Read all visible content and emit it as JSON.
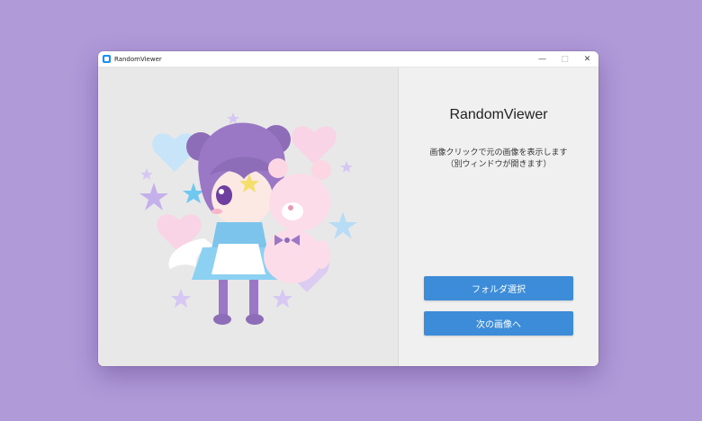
{
  "window": {
    "title": "RandomViewer",
    "controls": {
      "minimize": "—",
      "maximize": "□",
      "close": "✕"
    }
  },
  "main": {
    "heading": "RandomViewer",
    "instruction_line1": "画像クリックで元の画像を表示します",
    "instruction_line2": "（別ウィンドウが開きます）",
    "folder_button": "フォルダ選択",
    "next_button": "次の画像へ"
  },
  "colors": {
    "desktop": "#b09ad8",
    "button": "#3d8cd9",
    "image_bg": "#e8e8e8"
  },
  "icons": [
    "app-icon",
    "minimize-icon",
    "maximize-icon",
    "close-icon"
  ]
}
